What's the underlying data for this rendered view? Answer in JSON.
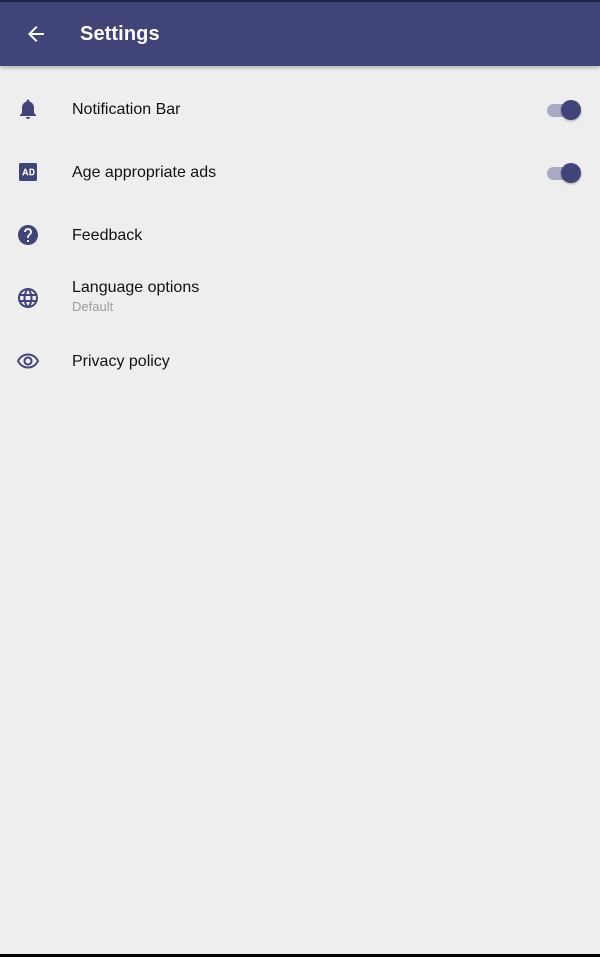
{
  "header": {
    "title": "Settings",
    "back_icon": "arrow-back-icon",
    "background_color": "#414479"
  },
  "settings": {
    "notification_bar": {
      "label": "Notification Bar",
      "icon": "bell-icon",
      "enabled": true
    },
    "age_appropriate_ads": {
      "label": "Age appropriate ads",
      "icon": "ad-icon",
      "enabled": true
    },
    "feedback": {
      "label": "Feedback",
      "icon": "help-circle-icon"
    },
    "language_options": {
      "label": "Language options",
      "value": "Default",
      "icon": "globe-icon"
    },
    "privacy_policy": {
      "label": "Privacy policy",
      "icon": "eye-icon"
    }
  },
  "colors": {
    "accent": "#414479",
    "switch_track": "#a8a9c2",
    "background": "#eeeeee",
    "secondary_text": "#9e9e9e"
  }
}
